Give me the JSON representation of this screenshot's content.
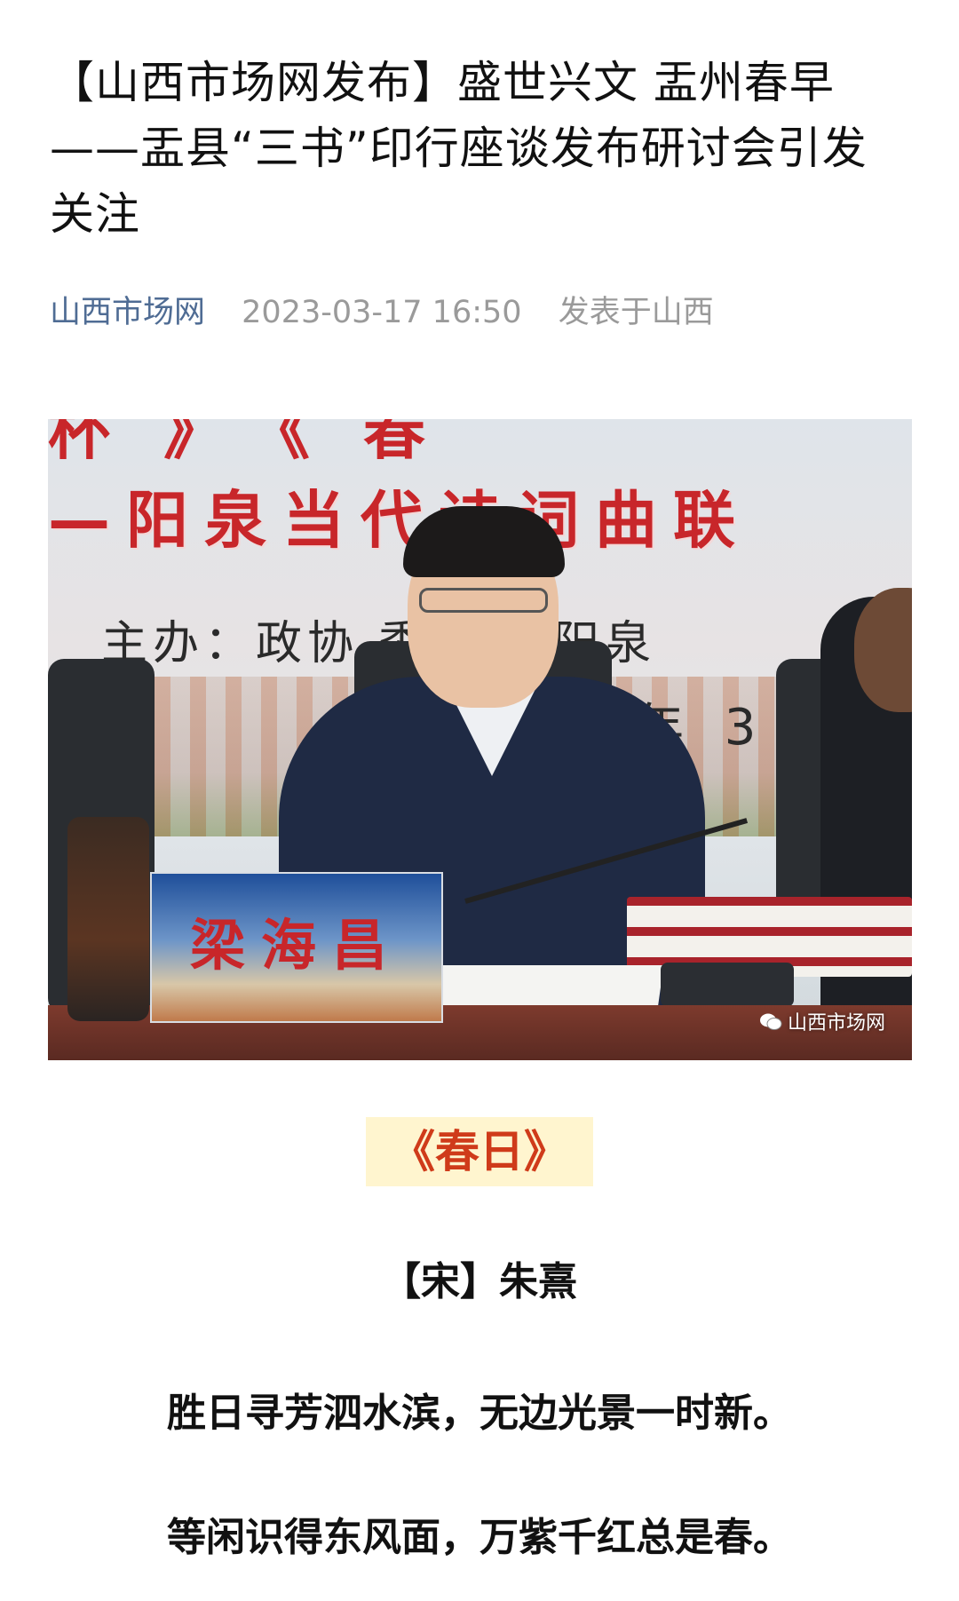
{
  "article": {
    "title": "【山西市场网发布】盛世兴文 盂州春早——盂县“三书”印行座谈发布研讨会引发关注",
    "source": "山西市场网",
    "datetime": "2023-03-17 16:50",
    "location": "发表于山西"
  },
  "photo": {
    "banner_top": "杯》《春",
    "banner_text": "—阳泉当代诗词曲联",
    "sponsor_text": "主办：政协  委员会 阳泉",
    "year_text": "年 3",
    "nameplate": "梁海昌",
    "watermark": "山西市场网",
    "watermark_icon": "wechat-icon"
  },
  "poem": {
    "title": "《春日》",
    "author": "【宋】朱熹",
    "lines": [
      "胜日寻芳泗水滨，无边光景一时新。",
      "等闲识得东风面，万紫千红总是春。"
    ]
  },
  "colors": {
    "source_link": "#4f6c94",
    "meta_gray": "#9a9a9a",
    "poem_title": "#cf3b1a",
    "poem_title_bg": "#fff5cf"
  }
}
